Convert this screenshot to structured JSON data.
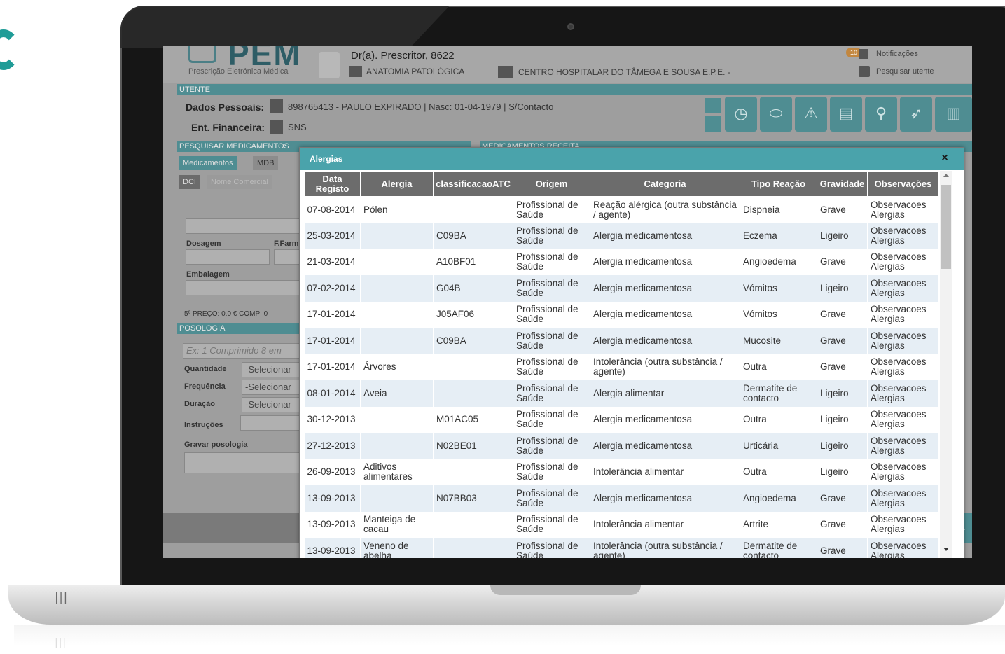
{
  "header": {
    "logo_text": "PEM",
    "logo_subtitle": "Prescrição Eletrónica Médica",
    "prescriber": "Dr(a). Prescritor, 8622",
    "specialty": "ANATOMIA PATOLÓGICA",
    "hospital": "CENTRO HOSPITALAR DO TÂMEGA E SOUSA E.P.E. -",
    "notifications_count": "10",
    "notifications_label": "Notificações",
    "search_patient_label": "Pesquisar utente"
  },
  "utente": {
    "section_label": "UTENTE",
    "personal_label": "Dados Pessoais:",
    "personal_value": "898765413 - PAULO EXPIRADO | Nasc: 01-04-1979 | S/Contacto",
    "financial_label": "Ent. Financeira:",
    "financial_value": "SNS"
  },
  "left_panel": {
    "search_section": "PESQUISAR MEDICAMENTOS",
    "right_section": "MEDICAMENTOS RECEITA",
    "tab_medicamentos": "Medicamentos",
    "tab_mdb": "MDB",
    "subtab_dci": "DCI",
    "subtab_nome": "Nome Comercial",
    "dosagem_label": "Dosagem",
    "ffarm_label": "F.Farm",
    "embalagem_label": "Embalagem",
    "preco_text": "5º PREÇO:  0.0 €   COMP: 0",
    "posologia_section": "POSOLOGIA",
    "posologia_placeholder": "Ex: 1 Comprimido 8 em",
    "quantidade_label": "Quantidade",
    "quantidade_value": "-Selecionar",
    "frequencia_label": "Frequência",
    "frequencia_value": "-Selecionar",
    "duracao_label": "Duração",
    "duracao_value": "-Selecionar",
    "instrucoes_label": "Instruções",
    "gravar_label": "Gravar posologia"
  },
  "modal": {
    "title": "Alergias",
    "close_symbol": "×",
    "columns": [
      "Data Registo",
      "Alergia",
      "classificacaoATC",
      "Origem",
      "Categoria",
      "Tipo Reação",
      "Gravidade",
      "Observações"
    ],
    "rows": [
      [
        "07-08-2014",
        "Pólen",
        "",
        "Profissional de Saúde",
        "Reação alérgica (outra substância / agente)",
        "Dispneia",
        "Grave",
        "Observacoes Alergias"
      ],
      [
        "25-03-2014",
        "",
        "C09BA",
        "Profissional de Saúde",
        "Alergia medicamentosa",
        "Eczema",
        "Ligeiro",
        "Observacoes Alergias"
      ],
      [
        "21-03-2014",
        "",
        "A10BF01",
        "Profissional de Saúde",
        "Alergia medicamentosa",
        "Angioedema",
        "Grave",
        "Observacoes Alergias"
      ],
      [
        "07-02-2014",
        "",
        "G04B",
        "Profissional de Saúde",
        "Alergia medicamentosa",
        "Vómitos",
        "Ligeiro",
        "Observacoes Alergias"
      ],
      [
        "17-01-2014",
        "",
        "J05AF06",
        "Profissional de Saúde",
        "Alergia medicamentosa",
        "Vómitos",
        "Grave",
        "Observacoes Alergias"
      ],
      [
        "17-01-2014",
        "",
        "C09BA",
        "Profissional de Saúde",
        "Alergia medicamentosa",
        "Mucosite",
        "Grave",
        "Observacoes Alergias"
      ],
      [
        "17-01-2014",
        "Árvores",
        "",
        "Profissional de Saúde",
        "Intolerância (outra substância / agente)",
        "Outra",
        "Grave",
        "Observacoes Alergias"
      ],
      [
        "08-01-2014",
        "Aveia",
        "",
        "Profissional de Saúde",
        "Alergia alimentar",
        "Dermatite de contacto",
        "Ligeiro",
        "Observacoes Alergias"
      ],
      [
        "30-12-2013",
        "",
        "M01AC05",
        "Profissional de Saúde",
        "Alergia medicamentosa",
        "Outra",
        "Ligeiro",
        "Observacoes Alergias"
      ],
      [
        "27-12-2013",
        "",
        "N02BE01",
        "Profissional de Saúde",
        "Alergia medicamentosa",
        "Urticária",
        "Ligeiro",
        "Observacoes Alergias"
      ],
      [
        "26-09-2013",
        "Aditivos alimentares",
        "",
        "Profissional de Saúde",
        "Intolerância alimentar",
        "Outra",
        "Ligeiro",
        "Observacoes Alergias"
      ],
      [
        "13-09-2013",
        "",
        "N07BB03",
        "Profissional de Saúde",
        "Alergia medicamentosa",
        "Angioedema",
        "Grave",
        "Observacoes Alergias"
      ],
      [
        "13-09-2013",
        "Manteiga de cacau",
        "",
        "Profissional de Saúde",
        "Intolerância alimentar",
        "Artrite",
        "Grave",
        "Observacoes Alergias"
      ],
      [
        "13-09-2013",
        "Veneno de abelha",
        "",
        "Profissional de Saúde",
        "Intolerância (outra substância / agente)",
        "Dermatite de contacto",
        "Grave",
        "Observacoes Alergias"
      ]
    ]
  },
  "colors": {
    "modal_header": "#4aa3ab",
    "table_header": "#6c6c6c",
    "row_alt": "#e6eef5",
    "app_accent": "#4f8d92",
    "brand_teal": "#1f9c97"
  },
  "icons": {
    "toolbar": [
      "history-icon",
      "pill-icon",
      "warning-icon",
      "clipboard-icon",
      "fall-icon",
      "run-icon",
      "book-icon"
    ]
  }
}
